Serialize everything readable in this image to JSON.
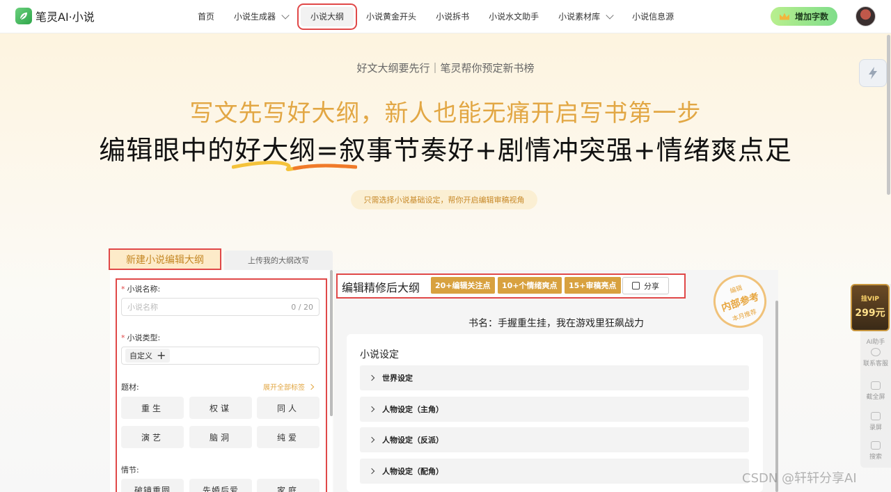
{
  "nav": {
    "brand": "笔灵AI·小说",
    "items": [
      {
        "label": "首页",
        "has_dropdown": false,
        "active": false
      },
      {
        "label": "小说生成器",
        "has_dropdown": true,
        "active": false
      },
      {
        "label": "小说大纲",
        "has_dropdown": false,
        "active": true
      },
      {
        "label": "小说黄金开头",
        "has_dropdown": false,
        "active": false
      },
      {
        "label": "小说拆书",
        "has_dropdown": false,
        "active": false
      },
      {
        "label": "小说水文助手",
        "has_dropdown": false,
        "active": false
      },
      {
        "label": "小说素材库",
        "has_dropdown": true,
        "active": false
      },
      {
        "label": "小说信息源",
        "has_dropdown": false,
        "active": false
      }
    ],
    "add_words_label": "增加字数"
  },
  "hero": {
    "sub_slogan": "好文大纲要先行｜笔灵帮你预定新书榜",
    "headline_1": "写文先写好大纲，新人也能无痛开启写书第一步",
    "headline_2": "编辑眼中的好大纲=叙事节奏好+剧情冲突强+情绪爽点足",
    "hint": "只需选择小说基础设定，帮你开启编辑审稿视角"
  },
  "left": {
    "tab_new": "新建小说编辑大纲",
    "tab_upload": "上传我的大纲改写",
    "name_label": "小说名称:",
    "name_placeholder": "小说名称",
    "name_count": "0 / 20",
    "type_label": "小说类型:",
    "type_chip": "自定义",
    "theme_label": "题材:",
    "expand_label": "展开全部标签",
    "theme_chips": [
      "重生",
      "权谋",
      "同人",
      "演艺",
      "脑洞",
      "纯爱"
    ],
    "plot_label": "情节:",
    "plot_chips": [
      "破镜重圆",
      "先婚后爱",
      "家庭"
    ]
  },
  "right": {
    "title": "编辑精修后大纲",
    "badges": [
      "20+编辑关注点",
      "10+个情绪爽点",
      "15+审稿亮点"
    ],
    "share_label": "分享",
    "stamp": {
      "top": "编辑",
      "main": "内部参考",
      "bottom": "本月推荐"
    },
    "book_name": "书名：手握重生挂，我在游戏里狂飙战力",
    "settings_title": "小说设定",
    "settings_rows": [
      "世界设定",
      "人物设定（主角）",
      "人物设定（反派）",
      "人物设定（配角）"
    ]
  },
  "side": {
    "vip_top": "挂VIP",
    "vip_price": "299元",
    "tools": [
      "AI助手",
      "联系客服",
      "截全屏",
      "录屏",
      "搜索"
    ]
  },
  "watermark": "CSDN @轩轩分享AI",
  "colors": {
    "accent": "#e2a744",
    "badge": "#d8a13f",
    "highlight_box": "#e04848",
    "brand_green": "#2fa64b"
  }
}
